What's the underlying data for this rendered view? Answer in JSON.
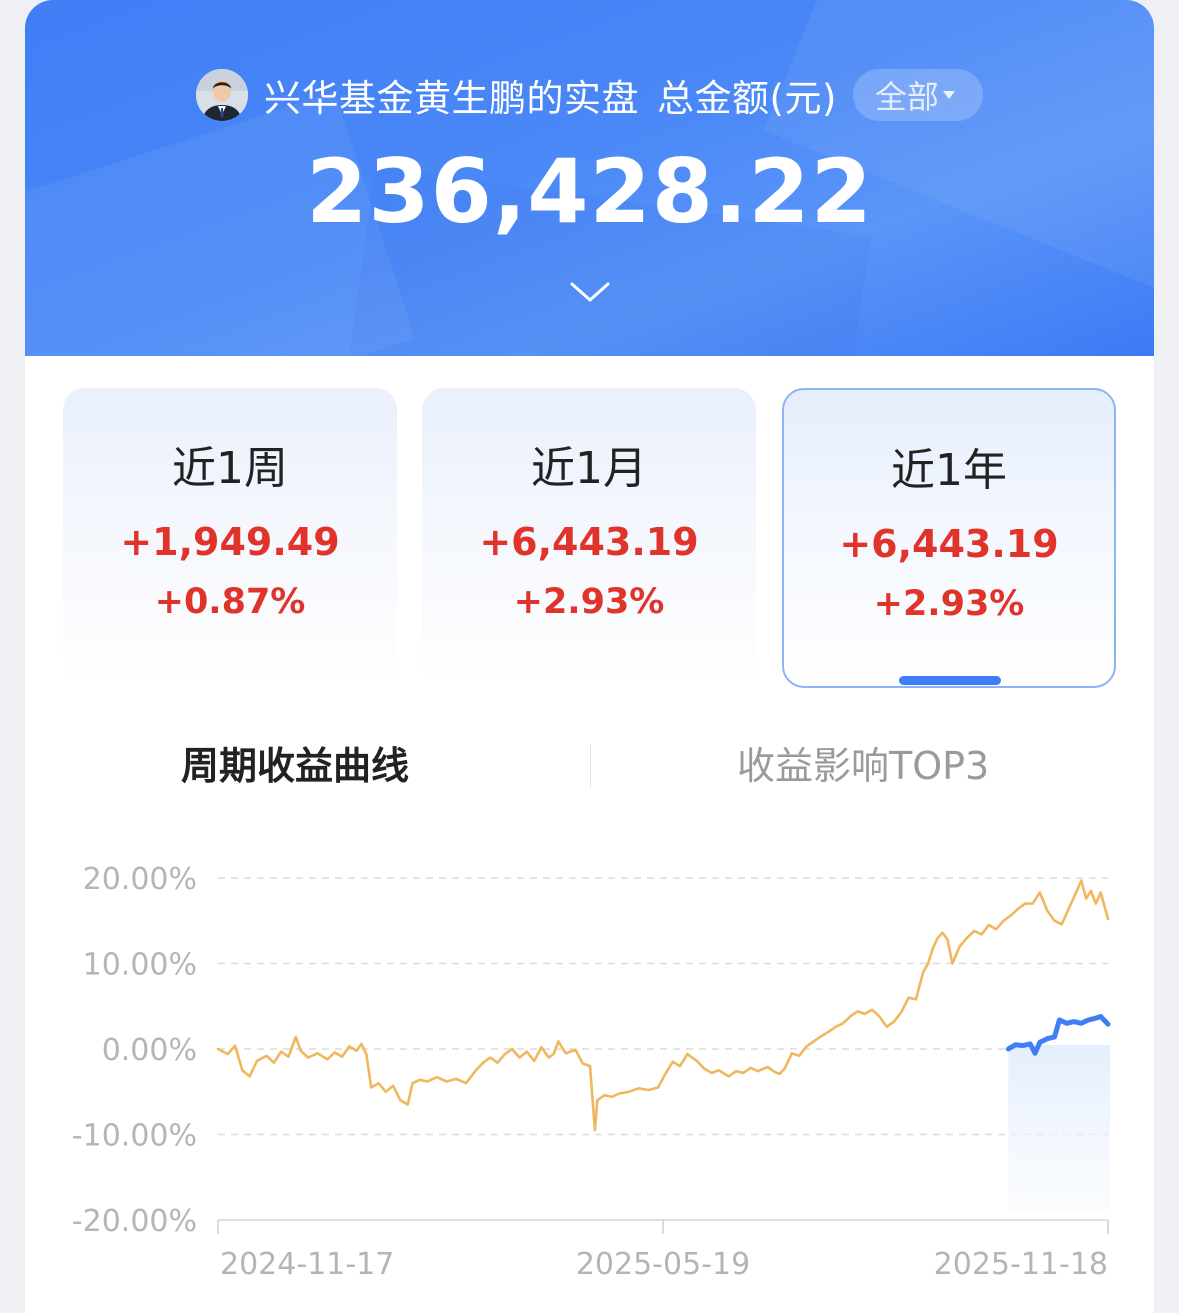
{
  "header": {
    "owner_name": "兴华基金黄生鹏的实盘",
    "total_label": "总金额(元)",
    "scope_label": "全部",
    "total_amount": "236,428.22",
    "colors": {
      "primary": "#3f7ef6"
    }
  },
  "periods": [
    {
      "label": "近1周",
      "amount": "+1,949.49",
      "percent": "+0.87%",
      "selected": false
    },
    {
      "label": "近1月",
      "amount": "+6,443.19",
      "percent": "+2.93%",
      "selected": false
    },
    {
      "label": "近1年",
      "amount": "+6,443.19",
      "percent": "+2.93%",
      "selected": true
    }
  ],
  "tabs": [
    {
      "label": "周期收益曲线",
      "active": true
    },
    {
      "label": "收益影响TOP3",
      "active": false
    }
  ],
  "icons": {
    "expand": "chevron-down-icon",
    "scope_caret": "caret-down-icon",
    "avatar": "avatar"
  },
  "chart_data": {
    "type": "line",
    "title": "",
    "xlabel": "",
    "ylabel": "",
    "ylim": [
      -20,
      20
    ],
    "yticks": [
      "20.00%",
      "10.00%",
      "0.00%",
      "-10.00%",
      "-20.00%"
    ],
    "xticks": [
      "2024-11-17",
      "2025-05-19",
      "2025-11-18"
    ],
    "grid": true,
    "colors": {
      "series_long": "#f0b75e",
      "series_recent": "#3f7ef6",
      "positive": "#e0332a"
    },
    "series": [
      {
        "color": "#f0b75e",
        "points": [
          [
            "2024-11-17",
            0.0
          ],
          [
            "2024-11-21",
            -0.6
          ],
          [
            "2024-11-24",
            0.4
          ],
          [
            "2024-11-27",
            -2.5
          ],
          [
            "2024-11-30",
            -3.2
          ],
          [
            "2024-12-03",
            -1.4
          ],
          [
            "2024-12-07",
            -0.8
          ],
          [
            "2024-12-10",
            -1.6
          ],
          [
            "2024-12-13",
            -0.3
          ],
          [
            "2024-12-16",
            -0.9
          ],
          [
            "2024-12-19",
            1.4
          ],
          [
            "2024-12-21",
            -0.2
          ],
          [
            "2024-12-24",
            -1.0
          ],
          [
            "2024-12-28",
            -0.5
          ],
          [
            "2025-01-01",
            -1.2
          ],
          [
            "2025-01-04",
            -0.4
          ],
          [
            "2025-01-07",
            -0.9
          ],
          [
            "2025-01-10",
            0.3
          ],
          [
            "2025-01-13",
            -0.2
          ],
          [
            "2025-01-15",
            0.6
          ],
          [
            "2025-01-17",
            -0.6
          ],
          [
            "2025-01-19",
            -4.5
          ],
          [
            "2025-01-22",
            -4.0
          ],
          [
            "2025-01-25",
            -5.0
          ],
          [
            "2025-01-28",
            -4.3
          ],
          [
            "2025-01-31",
            -6.0
          ],
          [
            "2025-02-03",
            -6.5
          ],
          [
            "2025-02-05",
            -4.0
          ],
          [
            "2025-02-08",
            -3.6
          ],
          [
            "2025-02-11",
            -3.8
          ],
          [
            "2025-02-15",
            -3.3
          ],
          [
            "2025-02-19",
            -3.8
          ],
          [
            "2025-02-23",
            -3.5
          ],
          [
            "2025-02-27",
            -4.0
          ],
          [
            "2025-03-03",
            -2.5
          ],
          [
            "2025-03-06",
            -1.6
          ],
          [
            "2025-03-09",
            -1.0
          ],
          [
            "2025-03-12",
            -1.6
          ],
          [
            "2025-03-15",
            -0.6
          ],
          [
            "2025-03-18",
            0.0
          ],
          [
            "2025-03-21",
            -1.0
          ],
          [
            "2025-03-24",
            -0.3
          ],
          [
            "2025-03-27",
            -1.4
          ],
          [
            "2025-03-30",
            0.2
          ],
          [
            "2025-04-02",
            -1.0
          ],
          [
            "2025-04-04",
            -0.6
          ],
          [
            "2025-04-06",
            0.9
          ],
          [
            "2025-04-09",
            -0.5
          ],
          [
            "2025-04-13",
            -0.1
          ],
          [
            "2025-04-16",
            -1.7
          ],
          [
            "2025-04-19",
            -2.0
          ],
          [
            "2025-04-21",
            -9.5
          ],
          [
            "2025-04-22",
            -6.0
          ],
          [
            "2025-04-25",
            -5.4
          ],
          [
            "2025-04-28",
            -5.6
          ],
          [
            "2025-05-01",
            -5.2
          ],
          [
            "2025-05-05",
            -5.0
          ],
          [
            "2025-05-09",
            -4.6
          ],
          [
            "2025-05-13",
            -4.8
          ],
          [
            "2025-05-17",
            -4.5
          ],
          [
            "2025-05-20",
            -2.9
          ],
          [
            "2025-05-23",
            -1.5
          ],
          [
            "2025-05-26",
            -2.0
          ],
          [
            "2025-05-29",
            -0.6
          ],
          [
            "2025-06-02",
            -1.4
          ],
          [
            "2025-06-05",
            -2.3
          ],
          [
            "2025-06-08",
            -2.8
          ],
          [
            "2025-06-11",
            -2.5
          ],
          [
            "2025-06-15",
            -3.2
          ],
          [
            "2025-06-18",
            -2.6
          ],
          [
            "2025-06-21",
            -2.8
          ],
          [
            "2025-06-24",
            -2.2
          ],
          [
            "2025-06-27",
            -2.6
          ],
          [
            "2025-07-01",
            -2.1
          ],
          [
            "2025-07-04",
            -2.7
          ],
          [
            "2025-07-06",
            -2.9
          ],
          [
            "2025-07-08",
            -2.3
          ],
          [
            "2025-07-11",
            -0.5
          ],
          [
            "2025-07-14",
            -0.8
          ],
          [
            "2025-07-17",
            0.3
          ],
          [
            "2025-07-20",
            0.9
          ],
          [
            "2025-07-23",
            1.5
          ],
          [
            "2025-07-26",
            2.0
          ],
          [
            "2025-07-29",
            2.6
          ],
          [
            "2025-08-01",
            3.0
          ],
          [
            "2025-08-04",
            3.8
          ],
          [
            "2025-08-07",
            4.4
          ],
          [
            "2025-08-10",
            4.1
          ],
          [
            "2025-08-13",
            4.6
          ],
          [
            "2025-08-16",
            3.8
          ],
          [
            "2025-08-19",
            2.6
          ],
          [
            "2025-08-22",
            3.2
          ],
          [
            "2025-08-25",
            4.3
          ],
          [
            "2025-08-28",
            6.0
          ],
          [
            "2025-08-31",
            5.8
          ],
          [
            "2025-09-03",
            9.0
          ],
          [
            "2025-09-05",
            10.0
          ],
          [
            "2025-09-07",
            11.8
          ],
          [
            "2025-09-09",
            13.0
          ],
          [
            "2025-09-11",
            13.6
          ],
          [
            "2025-09-13",
            12.8
          ],
          [
            "2025-09-15",
            10.0
          ],
          [
            "2025-09-18",
            12.0
          ],
          [
            "2025-09-21",
            13.0
          ],
          [
            "2025-09-24",
            13.8
          ],
          [
            "2025-09-27",
            13.4
          ],
          [
            "2025-09-30",
            14.5
          ],
          [
            "2025-10-03",
            14.0
          ],
          [
            "2025-10-06",
            15.0
          ],
          [
            "2025-10-09",
            15.6
          ],
          [
            "2025-10-12",
            16.4
          ],
          [
            "2025-10-15",
            17.0
          ],
          [
            "2025-10-18",
            17.0
          ],
          [
            "2025-10-21",
            18.3
          ],
          [
            "2025-10-24",
            16.2
          ],
          [
            "2025-10-27",
            15.0
          ],
          [
            "2025-10-30",
            14.6
          ],
          [
            "2025-11-02",
            16.5
          ],
          [
            "2025-11-05",
            18.4
          ],
          [
            "2025-11-07",
            19.7
          ],
          [
            "2025-11-09",
            17.6
          ],
          [
            "2025-11-11",
            18.5
          ],
          [
            "2025-11-13",
            17.0
          ],
          [
            "2025-11-15",
            18.3
          ],
          [
            "2025-11-18",
            15.2
          ]
        ]
      },
      {
        "color": "#3f7ef6",
        "points": [
          [
            "2025-10-08",
            0.0
          ],
          [
            "2025-10-11",
            0.5
          ],
          [
            "2025-10-14",
            0.4
          ],
          [
            "2025-10-17",
            0.6
          ],
          [
            "2025-10-19",
            -0.5
          ],
          [
            "2025-10-21",
            0.8
          ],
          [
            "2025-10-24",
            1.2
          ],
          [
            "2025-10-27",
            1.4
          ],
          [
            "2025-10-29",
            3.4
          ],
          [
            "2025-11-01",
            3.0
          ],
          [
            "2025-11-04",
            3.2
          ],
          [
            "2025-11-07",
            3.0
          ],
          [
            "2025-11-10",
            3.4
          ],
          [
            "2025-11-13",
            3.6
          ],
          [
            "2025-11-15",
            3.8
          ],
          [
            "2025-11-18",
            2.9
          ]
        ]
      }
    ]
  }
}
